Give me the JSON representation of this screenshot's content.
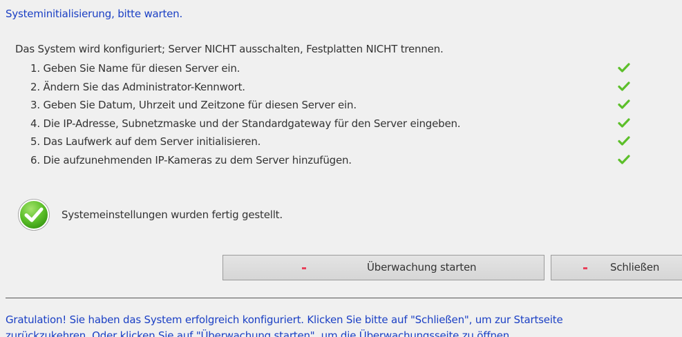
{
  "header": {
    "title": "Systeminitialisierung, bitte warten."
  },
  "intro": "Das System wird konfiguriert; Server NICHT ausschalten, Festplatten NICHT trennen.",
  "steps": [
    {
      "label": "1. Geben Sie Name für diesen Server ein.",
      "status": "done"
    },
    {
      "label": "2. Ändern Sie das Administrator-Kennwort.",
      "status": "done"
    },
    {
      "label": "3. Geben Sie Datum, Uhrzeit und Zeitzone für diesen Server ein.",
      "status": "done"
    },
    {
      "label": "4. Die IP-Adresse, Subnetzmaske und der Standardgateway für den Server eingeben.",
      "status": "done"
    },
    {
      "label": "5. Das Laufwerk auf dem Server initialisieren.",
      "status": "done"
    },
    {
      "label": "6. Die aufzunehmenden IP-Kameras zu dem Server hinzufügen.",
      "status": "done"
    }
  ],
  "completion": {
    "icon": "success-check-icon",
    "text": "Systemeinstellungen wurden fertig gestellt."
  },
  "buttons": {
    "start_label": "Überwachung starten",
    "close_label": "Schließen"
  },
  "footer": {
    "line1": "Gratulation! Sie haben das System erfolgreich konfiguriert. Klicken Sie bitte auf \"Schließen\", um zur Startseite",
    "line2": "zurückzukehren. Oder klicken Sie auf \"Überwachung starten\", um die Überwachungsseite zu öffnen."
  },
  "colors": {
    "link_text": "#1a3fc4",
    "check_green": "#5cbf2a",
    "button_dash": "#e8405a",
    "background": "#f0f0f0"
  }
}
